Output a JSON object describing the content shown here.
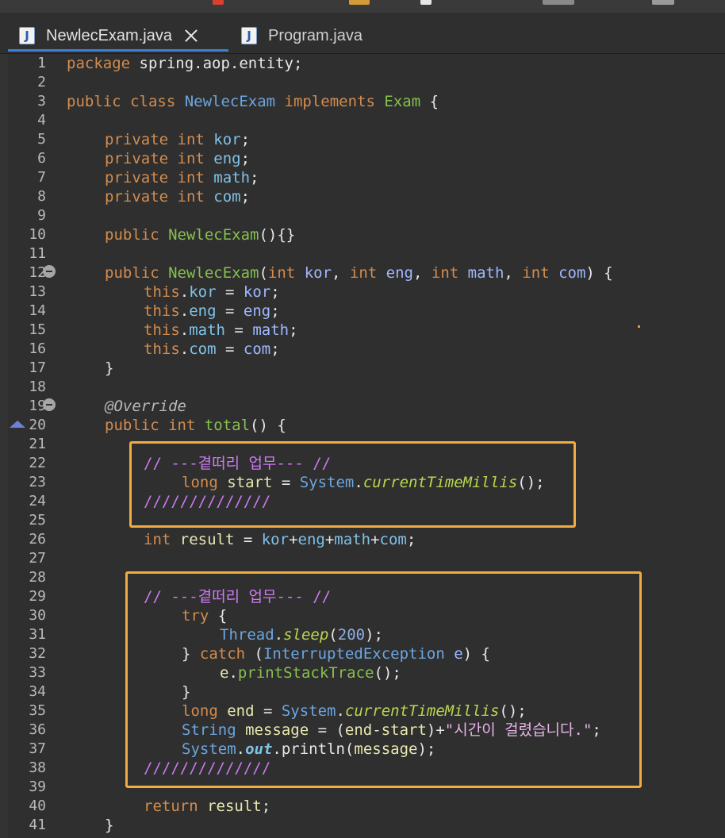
{
  "tabs": [
    {
      "label": "NewlecExam.java",
      "active": true,
      "icon": "java-file-icon"
    },
    {
      "label": "Program.java",
      "active": false,
      "icon": "java-file-icon"
    }
  ],
  "code": {
    "l1": [
      "package",
      " spring.aop.entity;"
    ],
    "l3": [
      "public class ",
      "NewlecExam",
      " implements ",
      "Exam",
      " {"
    ],
    "l5": [
      "private int ",
      "kor",
      ";"
    ],
    "l6": [
      "private int ",
      "eng",
      ";"
    ],
    "l7": [
      "private int ",
      "math",
      ";"
    ],
    "l8": [
      "private int ",
      "com",
      ";"
    ],
    "l10": [
      "public ",
      "NewlecExam",
      "(){}"
    ],
    "l12": [
      "public ",
      "NewlecExam",
      "(",
      "int ",
      "kor",
      ", ",
      "int ",
      "eng",
      ", ",
      "int ",
      "math",
      ", ",
      "int ",
      "com",
      ") {"
    ],
    "l13": [
      "this",
      ".",
      "kor",
      " = ",
      "kor",
      ";"
    ],
    "l14": [
      "this",
      ".",
      "eng",
      " = ",
      "eng",
      ";"
    ],
    "l15": [
      "this",
      ".",
      "math",
      " = ",
      "math",
      ";"
    ],
    "l16": [
      "this",
      ".",
      "com",
      " = ",
      "com",
      ";"
    ],
    "l17": [
      "}"
    ],
    "l19": [
      "@Override"
    ],
    "l20": [
      "public int ",
      "total",
      "() {"
    ],
    "l22": [
      "// ---곁떠리 업무--- //"
    ],
    "l23": [
      "long ",
      "start",
      " = ",
      "System",
      ".",
      "currentTimeMillis",
      "();"
    ],
    "l24": [
      "//////////////"
    ],
    "l26": [
      "int ",
      "result",
      " = ",
      "kor",
      "+",
      "eng",
      "+",
      "math",
      "+",
      "com",
      ";"
    ],
    "l29": [
      "// ---곁떠리 업무--- //"
    ],
    "l30": [
      "try",
      " {"
    ],
    "l31": [
      "Thread",
      ".",
      "sleep",
      "(",
      "200",
      ");"
    ],
    "l32": [
      "} ",
      "catch",
      " (",
      "InterruptedException",
      " ",
      "e",
      ") {"
    ],
    "l33": [
      "e",
      ".",
      "printStackTrace",
      "();"
    ],
    "l34": [
      "}"
    ],
    "l35": [
      "long ",
      "end",
      " = ",
      "System",
      ".",
      "currentTimeMillis",
      "();"
    ],
    "l36": [
      "String ",
      "message",
      " = (",
      "end",
      "-",
      "start",
      ")+",
      "\"시간이 걸렸습니다.\"",
      ";"
    ],
    "l37": [
      "System",
      ".",
      "out",
      ".println(",
      "message",
      ");"
    ],
    "l38": [
      "//////////////"
    ],
    "l40": [
      "return ",
      "result",
      ";"
    ],
    "l41": [
      "}"
    ]
  },
  "line_numbers": [
    "1",
    "2",
    "3",
    "4",
    "5",
    "6",
    "7",
    "8",
    "9",
    "10",
    "11",
    "12",
    "13",
    "14",
    "15",
    "16",
    "17",
    "18",
    "19",
    "20",
    "21",
    "22",
    "23",
    "24",
    "25",
    "26",
    "27",
    "28",
    "29",
    "30",
    "31",
    "32",
    "33",
    "34",
    "35",
    "36",
    "37",
    "38",
    "39",
    "40",
    "41"
  ]
}
